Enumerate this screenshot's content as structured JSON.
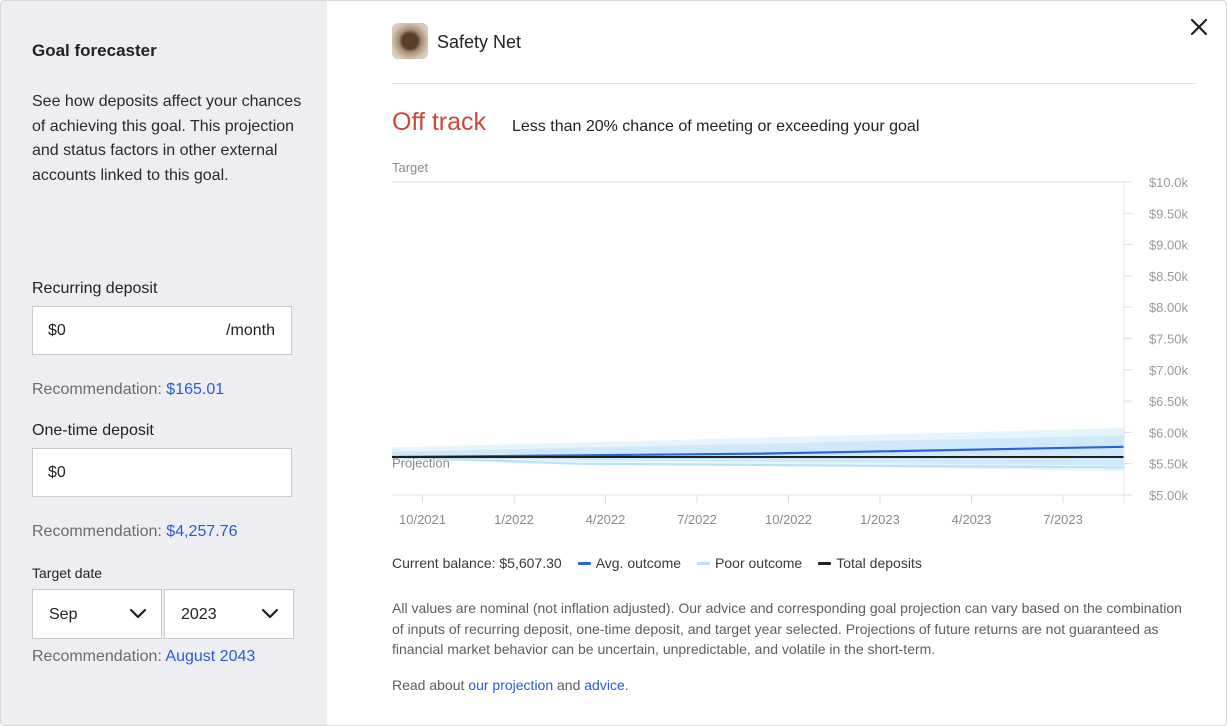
{
  "sidebar": {
    "title": "Goal forecaster",
    "description": "See how deposits affect your chances of achieving this goal. This projection and status factors in other external accounts linked to this goal.",
    "recurring": {
      "label": "Recurring deposit",
      "value": "$0",
      "suffix": "/month",
      "rec_prefix": "Recommendation: ",
      "rec_value": "$165.01"
    },
    "onetime": {
      "label": "One-time deposit",
      "value": "$0",
      "rec_prefix": "Recommendation: ",
      "rec_value": "$4,257.76"
    },
    "target_date": {
      "label": "Target date",
      "month": "Sep",
      "year": "2023",
      "rec_prefix": "Recommendation: ",
      "rec_value": "August 2043"
    }
  },
  "header": {
    "goal_name": "Safety Net",
    "close_icon": "close-icon"
  },
  "status": {
    "label": "Off track",
    "description": "Less than 20% chance of meeting or exceeding your goal",
    "color": "#d0463a"
  },
  "chart_data": {
    "type": "area",
    "target_label": "Target",
    "projection_label": "Projection",
    "x_ticks": [
      "10/2021",
      "1/2022",
      "4/2022",
      "7/2022",
      "10/2022",
      "1/2023",
      "4/2023",
      "7/2023"
    ],
    "x_range": [
      "2021-09",
      "2023-09"
    ],
    "y_ticks": [
      "$10.0k",
      "$9.50k",
      "$9.00k",
      "$8.50k",
      "$8.00k",
      "$7.50k",
      "$7.00k",
      "$6.50k",
      "$6.00k",
      "$5.50k",
      "$5.00k"
    ],
    "ylim": [
      5000,
      10000
    ],
    "target_value": 10000,
    "grid": false,
    "legend_position": "bottom",
    "series": [
      {
        "name": "Avg. outcome",
        "color": "#2c63d6",
        "x": [
          "2021-09",
          "2022-09",
          "2023-09"
        ],
        "values": [
          5607,
          5660,
          5770
        ]
      },
      {
        "name": "Poor outcome",
        "color": "#b9e2f5",
        "x": [
          "2021-09",
          "2022-03",
          "2023-09"
        ],
        "values": [
          5607,
          5500,
          5440
        ]
      },
      {
        "name": "Total deposits",
        "color": "#1f1f1f",
        "x": [
          "2021-09",
          "2023-09"
        ],
        "values": [
          5607,
          5607
        ]
      }
    ],
    "bands": [
      {
        "color": "#e6f3fc",
        "x": [
          "2021-09",
          "2023-09"
        ],
        "upper": [
          5760,
          6070
        ],
        "lower": [
          5560,
          5380
        ]
      },
      {
        "color": "#cfe8fa",
        "x": [
          "2021-09",
          "2023-09"
        ],
        "upper": [
          5690,
          5950
        ],
        "lower": [
          5590,
          5470
        ]
      }
    ]
  },
  "legend": {
    "balance": "Current balance: $5,607.30",
    "items": [
      {
        "label": "Avg. outcome",
        "color": "#2c63d6"
      },
      {
        "label": "Poor outcome",
        "color": "#b9e2f5"
      },
      {
        "label": "Total deposits",
        "color": "#1f1f1f"
      }
    ]
  },
  "disclaimer": "All values are nominal (not inflation adjusted). Our advice and corresponding goal projection can vary based on the combination of inputs of recurring deposit, one-time deposit, and target year selected. Projections of future returns are not guaranteed as financial market behavior can be uncertain, unpredictable, and volatile in the short-term.",
  "read_more": {
    "prefix": "Read about ",
    "link1": "our projection",
    "middle": " and ",
    "link2": "advice",
    "suffix": "."
  }
}
